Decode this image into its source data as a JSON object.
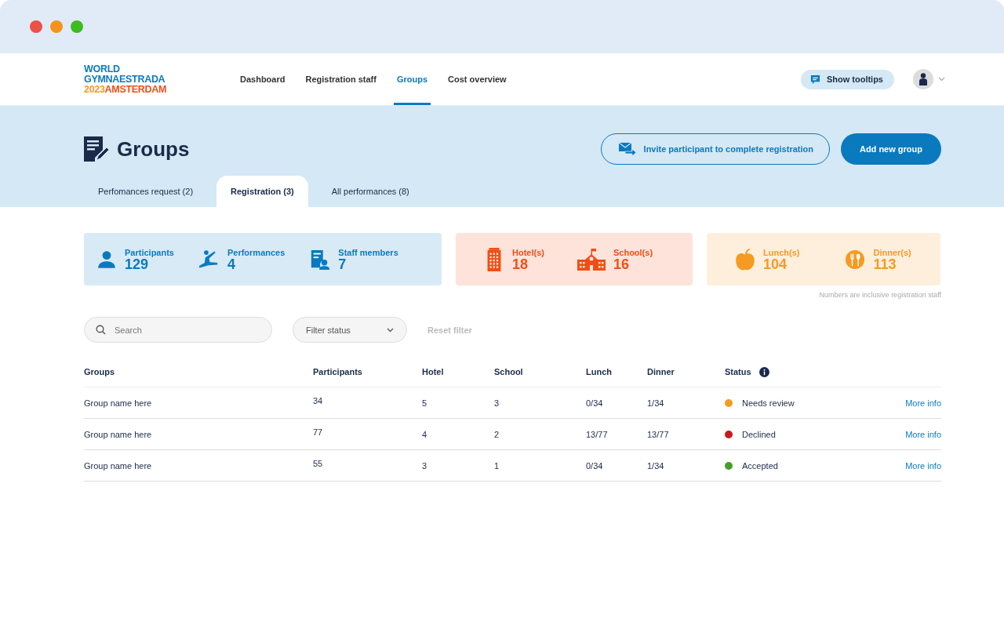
{
  "logo": {
    "line_1": "WORLD",
    "line_2": "GYMNAESTRADA",
    "year": "2023",
    "city": "AMSTERDAM"
  },
  "nav": {
    "items": [
      {
        "label": "Dashboard",
        "selected": false
      },
      {
        "label": "Registration staff",
        "selected": false
      },
      {
        "label": "Groups",
        "selected": true
      },
      {
        "label": "Cost overview",
        "selected": false
      }
    ],
    "tooltip_button": "Show tooltips"
  },
  "page": {
    "title": "Groups",
    "invite_button": "Invite participant to complete registration",
    "add_button": "Add new group"
  },
  "tabs": [
    {
      "label": "Perfomances request (2)",
      "selected": false
    },
    {
      "label": "Registration (3)",
      "selected": true
    },
    {
      "label": "All performances (8)",
      "selected": false
    }
  ],
  "stat_groups": [
    {
      "kind": "people",
      "items": [
        {
          "kind": "person",
          "label": "Participants",
          "value": "129"
        },
        {
          "kind": "dancer",
          "label": "Performances",
          "value": "4"
        },
        {
          "kind": "staff",
          "label": "Staff members",
          "value": "7"
        }
      ]
    },
    {
      "kind": "lodging",
      "items": [
        {
          "kind": "hotel",
          "label": "Hotel(s)",
          "value": "18"
        },
        {
          "kind": "school",
          "label": "School(s)",
          "value": "16"
        }
      ]
    },
    {
      "kind": "meals",
      "items": [
        {
          "kind": "apple",
          "label": "Lunch(s)",
          "value": "104"
        },
        {
          "kind": "cutlery",
          "label": "Dinner(s)",
          "value": "113"
        }
      ]
    }
  ],
  "stats_note": "Numbers are inclusive registration staff",
  "filters": {
    "search": {
      "placeholder": "Search"
    },
    "filter_status": "Filter status",
    "reset_filter": {
      "label": "Reset filter",
      "disabled": true
    }
  },
  "table": {
    "columns": [
      "Groups",
      "Participants",
      "Hotel",
      "School",
      "Lunch",
      "Dinner",
      "Status"
    ],
    "rows": [
      {
        "group": "Group name here",
        "participants": "34",
        "hotel": "5",
        "school": "3",
        "lunch": "0/34",
        "dinner": "1/34",
        "status": "Needs review",
        "color": "#f59a23",
        "link": "More info"
      },
      {
        "group": "Group name here",
        "participants": "77",
        "hotel": "4",
        "school": "2",
        "lunch": "13/77",
        "dinner": "13/77",
        "status": "Declined",
        "color": "#c8191e",
        "link": "More info"
      },
      {
        "group": "Group name here",
        "participants": "55",
        "hotel": "3",
        "school": "1",
        "lunch": "0/34",
        "dinner": "1/34",
        "status": "Accepted",
        "color": "#43a02a",
        "link": "More info"
      }
    ]
  }
}
